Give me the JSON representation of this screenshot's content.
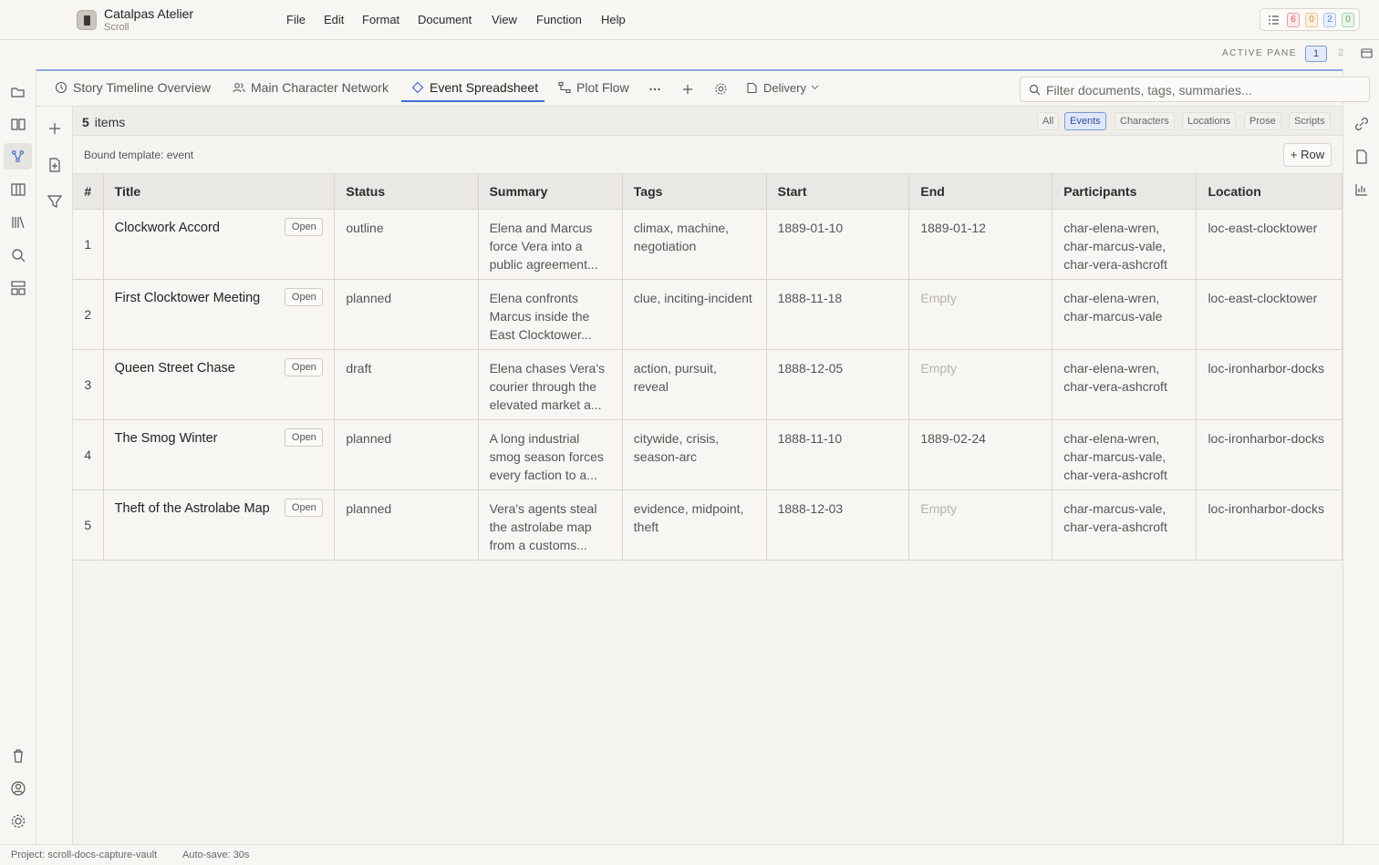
{
  "app": {
    "name": "Catalpas Atelier",
    "subtitle": "Scroll"
  },
  "menu": [
    "File",
    "Edit",
    "Format",
    "Document",
    "View",
    "Function",
    "Help"
  ],
  "badges": [
    {
      "value": "6",
      "color": "#d9534f"
    },
    {
      "value": "0",
      "color": "#e0a040"
    },
    {
      "value": "2",
      "color": "#4a7fd6"
    },
    {
      "value": "0",
      "color": "#5ca05c"
    }
  ],
  "active_pane": {
    "label": "ACTIVE PANE",
    "current": "1",
    "other": "2"
  },
  "tabs": [
    {
      "label": "Story Timeline Overview",
      "icon": "clock-icon"
    },
    {
      "label": "Main Character Network",
      "icon": "users-icon"
    },
    {
      "label": "Event Spreadsheet",
      "icon": "diamond-icon",
      "active": true
    },
    {
      "label": "Plot Flow",
      "icon": "flow-icon"
    }
  ],
  "delivery_label": "Delivery",
  "search": {
    "placeholder": "Filter documents, tags, summaries..."
  },
  "items": {
    "count": "5",
    "label": "items"
  },
  "filters": [
    "All",
    "Events",
    "Characters",
    "Locations",
    "Prose",
    "Scripts"
  ],
  "active_filter": "Events",
  "bound_template": "Bound template: event",
  "add_row_label": "+ Row",
  "table": {
    "columns": [
      "#",
      "Title",
      "Status",
      "Summary",
      "Tags",
      "Start",
      "End",
      "Participants",
      "Location"
    ],
    "open_label": "Open",
    "rows": [
      {
        "num": "1",
        "title": "Clockwork Accord",
        "status": "outline",
        "summary": "Elena and Marcus force Vera into a public agreement...",
        "tags": "climax, machine, negotiation",
        "start": "1889-01-10",
        "end": "1889-01-12",
        "participants": "char-elena-wren, char-marcus-vale, char-vera-ashcroft",
        "location": "loc-east-clocktower"
      },
      {
        "num": "2",
        "title": "First Clocktower Meeting",
        "status": "planned",
        "summary": "Elena confronts Marcus inside the East Clocktower...",
        "tags": "clue, inciting-incident",
        "start": "1888-11-18",
        "end": "Empty",
        "participants": "char-elena-wren, char-marcus-vale",
        "location": "loc-east-clocktower"
      },
      {
        "num": "3",
        "title": "Queen Street Chase",
        "status": "draft",
        "summary": "Elena chases Vera's courier through the elevated market a...",
        "tags": "action, pursuit, reveal",
        "start": "1888-12-05",
        "end": "Empty",
        "participants": "char-elena-wren, char-vera-ashcroft",
        "location": "loc-ironharbor-docks"
      },
      {
        "num": "4",
        "title": "The Smog Winter",
        "status": "planned",
        "summary": "A long industrial smog season forces every faction to a...",
        "tags": "citywide, crisis, season-arc",
        "start": "1888-11-10",
        "end": "1889-02-24",
        "participants": "char-elena-wren, char-marcus-vale, char-vera-ashcroft",
        "location": "loc-ironharbor-docks"
      },
      {
        "num": "5",
        "title": "Theft of the Astrolabe Map",
        "status": "planned",
        "summary": "Vera's agents steal the astrolabe map from a customs...",
        "tags": "evidence, midpoint, theft",
        "start": "1888-12-03",
        "end": "Empty",
        "participants": "char-marcus-vale, char-vera-ashcroft",
        "location": "loc-ironharbor-docks"
      }
    ]
  },
  "status_bar": {
    "project": "Project: scroll-docs-capture-vault",
    "autosave": "Auto-save: 30s"
  }
}
